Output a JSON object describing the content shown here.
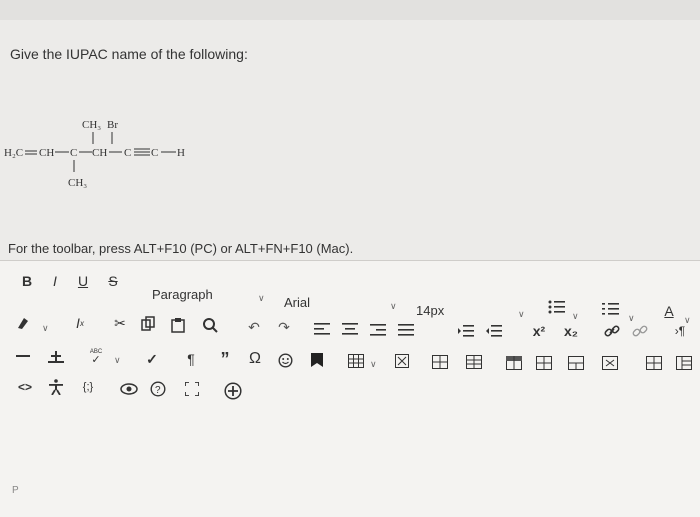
{
  "question": {
    "text": "Give the IUPAC name of the following:"
  },
  "molecule": {
    "top_labels": [
      "CH₃",
      "Br"
    ],
    "main_chain": "H₂C═CH—C—CH—C≡C—H",
    "bottom_label": "CH₃",
    "atoms": [
      "H₂C",
      "CH",
      "C",
      "CH",
      "C",
      "C",
      "H"
    ]
  },
  "toolbar_hint": "For the toolbar, press ALT+F10 (PC) or ALT+FN+F10 (Mac).",
  "toolbar": {
    "bold": "B",
    "italic": "I",
    "underline": "U",
    "strike": "S",
    "paragraph": "Paragraph",
    "font": "Arial",
    "size": "14px",
    "font_color": "A",
    "superscript": "x²",
    "subscript": "x₂",
    "pilcrow": "¶",
    "quote": "”",
    "omega": "Ω",
    "code": "<>",
    "embed": "{;}",
    "help": "?",
    "spell": "ABC"
  },
  "status": {
    "path": "P"
  },
  "icons": {
    "row1": [
      "bold",
      "italic",
      "underline",
      "strikethrough",
      "paragraph-select",
      "font-select",
      "size-select",
      "list-unordered",
      "list-ordered",
      "font-color"
    ],
    "row2": [
      "highlight-icon",
      "clear-format-icon",
      "cut-icon",
      "copy-icon",
      "paste-icon",
      "search-icon",
      "undo-icon",
      "redo-icon",
      "align-left-icon",
      "align-center-icon",
      "align-right-icon",
      "justify-icon",
      "indent-icon",
      "outdent-icon",
      "superscript",
      "subscript",
      "link-icon",
      "unlink-icon",
      "ltr-icon"
    ],
    "row3": [
      "hr-icon",
      "anchor-icon",
      "spellcheck-icon",
      "checkmark-icon",
      "pilcrow",
      "blockquote",
      "omega",
      "emoji-icon",
      "bookmark-icon",
      "table-icon",
      "table-props-icon",
      "table-grid-icons"
    ],
    "row4": [
      "code-icon",
      "accessibility-icon",
      "embed-icon",
      "preview-icon",
      "help-icon",
      "fullscreen-icon",
      "add-content-icon"
    ]
  },
  "colors": {
    "background": "#ecebe9",
    "editor": "#f4f3f1",
    "text": "#2a2a2a"
  }
}
